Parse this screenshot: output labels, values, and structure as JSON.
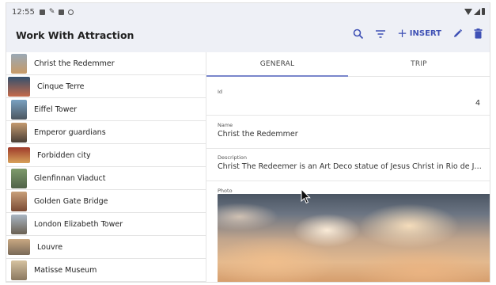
{
  "statusbar": {
    "time": "12:55"
  },
  "appbar": {
    "title": "Work With Attraction",
    "insert_label": "INSERT"
  },
  "list": {
    "items": [
      {
        "label": "Christ the Redemmer",
        "thumb": [
          "#9aa9b6",
          "#c79a66"
        ]
      },
      {
        "label": "Cinque Terre",
        "thumb": [
          "#33506e",
          "#c4694a"
        ]
      },
      {
        "label": "Eiffel Tower",
        "thumb": [
          "#7aa1c2",
          "#4c5660"
        ]
      },
      {
        "label": "Emperor guardians",
        "thumb": [
          "#c49a70",
          "#4a3f36"
        ]
      },
      {
        "label": "Forbidden city",
        "thumb": [
          "#9f3a2a",
          "#d7a15a"
        ]
      },
      {
        "label": "Glenfinnan Viaduct",
        "thumb": [
          "#7e9b6c",
          "#506248"
        ]
      },
      {
        "label": "Golden Gate Bridge",
        "thumb": [
          "#c9a07a",
          "#7a4a34"
        ]
      },
      {
        "label": "London Elizabeth Tower",
        "thumb": [
          "#a9b6c4",
          "#6a6052"
        ]
      },
      {
        "label": "Louvre",
        "thumb": [
          "#c9a882",
          "#7a6a58"
        ]
      },
      {
        "label": "Matisse Museum",
        "thumb": [
          "#d6c2a0",
          "#8a7860"
        ]
      }
    ]
  },
  "detail": {
    "tabs": [
      {
        "label": "GENERAL",
        "active": true
      },
      {
        "label": "TRIP",
        "active": false
      }
    ],
    "id_caption": "Id",
    "id_value": "4",
    "name_caption": "Name",
    "name_value": "Christ the Redemmer",
    "description_caption": "Description",
    "description_value": "Christ The Redeemer is an Art Deco statue of Jesus Christ in Rio de Janeiro, Bra...",
    "photo_caption": "Photo"
  },
  "colors": {
    "accent": "#3f51b5",
    "appbar_bg": "#eef0f6",
    "tab_indicator": "#7986cb"
  },
  "icons": [
    "search-icon",
    "filter-icon",
    "add-icon",
    "edit-icon",
    "delete-icon"
  ]
}
